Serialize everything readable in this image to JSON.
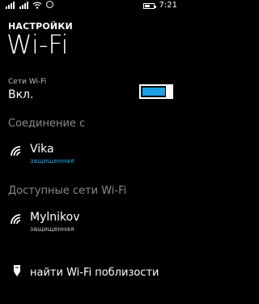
{
  "statusbar": {
    "time": "7:21",
    "battery_level": 0.6
  },
  "header": {
    "app_title": "НАСТРОЙКИ",
    "page_title": "Wi-Fi"
  },
  "wifi_toggle": {
    "label": "Сети Wi-Fi",
    "state": "Вкл.",
    "on": true
  },
  "connected": {
    "heading": "Соединение с",
    "network": {
      "name": "Vika",
      "status": "защищенная",
      "status_color": "#1ba1e2"
    }
  },
  "available": {
    "heading": "Доступные сети Wi-Fi",
    "networks": [
      {
        "name": "Mylnikov",
        "status": "защищенная"
      }
    ]
  },
  "nearby_link": {
    "label": "найти Wi-Fi поблизости"
  },
  "colors": {
    "accent": "#1ba1e2",
    "background": "#000000",
    "section_gray": "#8a8a8a"
  }
}
